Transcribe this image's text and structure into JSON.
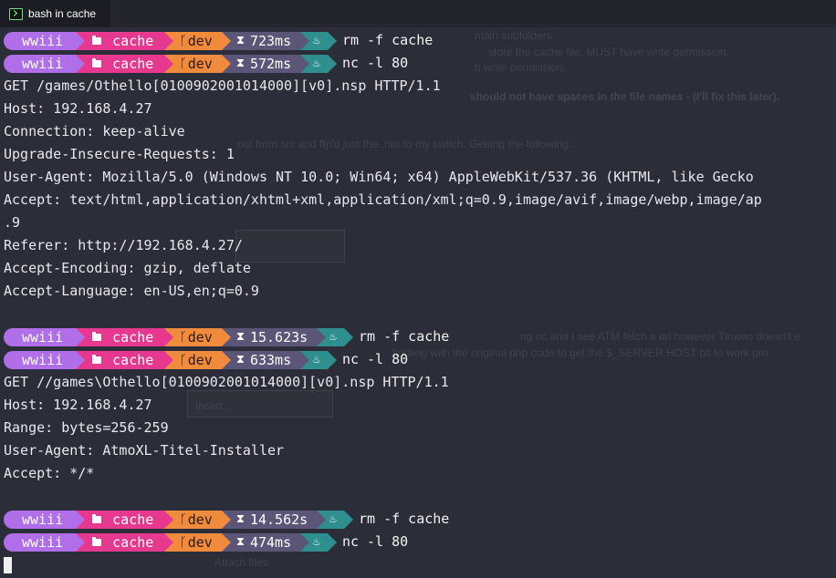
{
  "window": {
    "tab_title": "bash in cache"
  },
  "prompt": {
    "user": "wwiii",
    "dir": "cache",
    "branch": "dev",
    "colors": {
      "user": "#b06ee8",
      "dir": "#e6388e",
      "branch": "#f08a3c",
      "time": "#5b5678",
      "status": "#2f8f8f"
    }
  },
  "lines": [
    {
      "type": "prompt",
      "time": "723ms",
      "cmd": "rm -f cache"
    },
    {
      "type": "prompt",
      "time": "572ms",
      "cmd": "nc -l 80"
    },
    {
      "type": "out",
      "text": "GET /games/Othello[0100902001014000][v0].nsp HTTP/1.1"
    },
    {
      "type": "out",
      "text": "Host: 192.168.4.27"
    },
    {
      "type": "out",
      "text": "Connection: keep-alive"
    },
    {
      "type": "out",
      "text": "Upgrade-Insecure-Requests: 1"
    },
    {
      "type": "out",
      "text": "User-Agent: Mozilla/5.0 (Windows NT 10.0; Win64; x64) AppleWebKit/537.36 (KHTML, like Gecko"
    },
    {
      "type": "out",
      "text": "Accept: text/html,application/xhtml+xml,application/xml;q=0.9,image/avif,image/webp,image/ap"
    },
    {
      "type": "out",
      "text": ".9"
    },
    {
      "type": "out",
      "text": "Referer: http://192.168.4.27/"
    },
    {
      "type": "out",
      "text": "Accept-Encoding: gzip, deflate"
    },
    {
      "type": "out",
      "text": "Accept-Language: en-US,en;q=0.9"
    },
    {
      "type": "out",
      "text": ""
    },
    {
      "type": "prompt",
      "time": "15.623s",
      "cmd": "rm -f cache"
    },
    {
      "type": "prompt",
      "time": "633ms",
      "cmd": "nc -l 80"
    },
    {
      "type": "out",
      "text": "GET //games\\Othello[0100902001014000][v0].nsp HTTP/1.1"
    },
    {
      "type": "out",
      "text": "Host: 192.168.4.27"
    },
    {
      "type": "out",
      "text": "Range: bytes=256-259"
    },
    {
      "type": "out",
      "text": "User-Agent: AtmoXL-Titel-Installer"
    },
    {
      "type": "out",
      "text": "Accept: */*"
    },
    {
      "type": "out",
      "text": ""
    },
    {
      "type": "prompt",
      "time": "14.562s",
      "cmd": "rm -f cache"
    },
    {
      "type": "prompt",
      "time": "474ms",
      "cmd": "nc -l 80"
    },
    {
      "type": "cursor"
    }
  ]
}
